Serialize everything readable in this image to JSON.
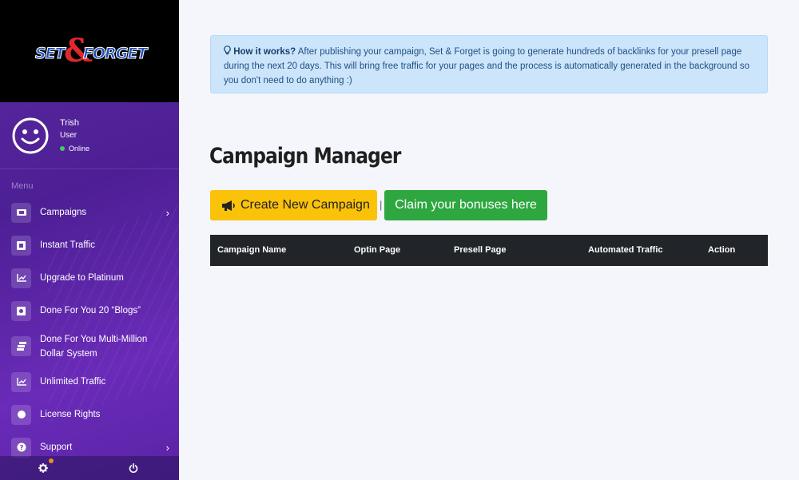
{
  "brand": {
    "set": "SET",
    "amp": "&",
    "forget": "FORGET"
  },
  "user": {
    "name": "Trish",
    "role": "User",
    "status": "Online"
  },
  "menu": {
    "label": "Menu",
    "items": [
      {
        "label": "Campaigns",
        "icon": "campaigns-icon",
        "chevron": true
      },
      {
        "label": "Instant Traffic",
        "icon": "traffic-icon",
        "chevron": false
      },
      {
        "label": "Upgrade to Platinum",
        "icon": "chart-icon",
        "chevron": false
      },
      {
        "label": "Done For You 20 “Blogs”",
        "icon": "blog-icon",
        "chevron": false
      },
      {
        "label": "Done For You Multi-Million Dollar System",
        "icon": "stack-icon",
        "chevron": false
      },
      {
        "label": "Unlimited Traffic",
        "icon": "chart-icon",
        "chevron": false
      },
      {
        "label": "License Rights",
        "icon": "badge-icon",
        "chevron": false
      },
      {
        "label": "Support",
        "icon": "help-icon",
        "chevron": true
      }
    ]
  },
  "alert": {
    "title": "How it works?",
    "text": "After publishing your campaign, Set & Forget is going to generate hundreds of backlinks for your presell page during the next 20 days. This will bring free traffic for your pages and the process is automatically generated in the background so you don't need to do anything :)"
  },
  "main": {
    "title": "Campaign Manager",
    "create_button": "Create New Campaign",
    "separator": "|",
    "bonus_button": "Claim your bonuses here"
  },
  "table": {
    "columns": [
      "Campaign Name",
      "Optin Page",
      "Presell Page",
      "Automated Traffic",
      "Action"
    ]
  },
  "colors": {
    "accent_yellow": "#fbc20a",
    "accent_green": "#2ea740",
    "sidebar": "#5b2a9e",
    "table_head": "#212428"
  }
}
